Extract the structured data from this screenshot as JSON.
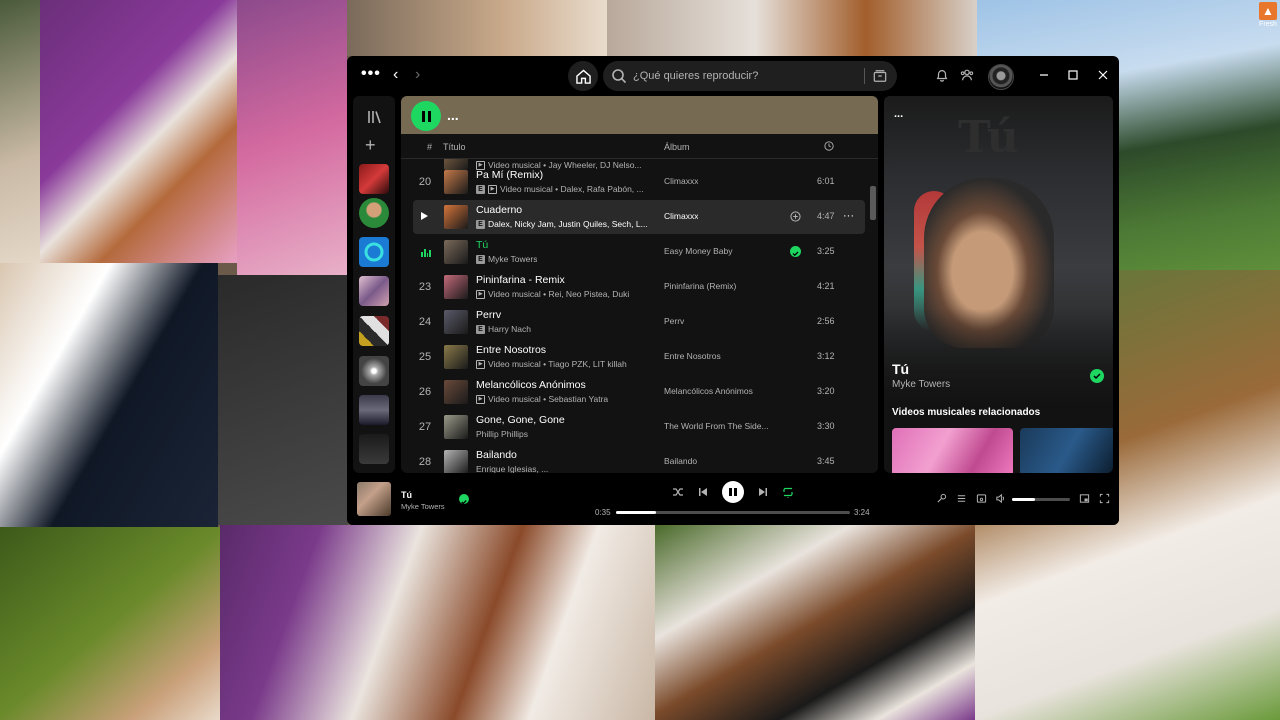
{
  "desktop": {
    "shortcut_label": "Fresh"
  },
  "titlebar": {
    "search_placeholder": "¿Qué quieres reproducir?"
  },
  "main": {
    "header_title": "...",
    "columns": {
      "num": "#",
      "title": "Título",
      "album": "Álbum"
    },
    "rows": [
      {
        "num": "",
        "title": "",
        "subtitle": "Video musical • Jay Wheeler, DJ Nelso...",
        "video": true,
        "explicit": false,
        "album": "",
        "duration": "",
        "state": "normal",
        "thumb": "#8a6a4a"
      },
      {
        "num": "20",
        "title": "Pa Mí (Remix)",
        "subtitle": "Video musical • Dalex, Rafa Pabón, ...",
        "video": true,
        "explicit": true,
        "album": "Climaxxx",
        "duration": "6:01",
        "state": "normal",
        "thumb": "#c47a4a"
      },
      {
        "num": "",
        "title": "Cuaderno",
        "subtitle": "Dalex, Nicky Jam, Justin Quiles, Sech, L...",
        "video": false,
        "explicit": true,
        "album": "Climaxxx",
        "duration": "4:47",
        "state": "hover",
        "thumb": "#d4743a"
      },
      {
        "num": "",
        "title": "Tú",
        "subtitle": "Myke Towers",
        "video": false,
        "explicit": true,
        "album": "Easy Money Baby",
        "duration": "3:25",
        "state": "playing",
        "thumb": "#7a6a5a"
      },
      {
        "num": "23",
        "title": "Pininfarina - Remix",
        "subtitle": "Video musical • Rei, Neo Pistea, Duki",
        "video": true,
        "explicit": false,
        "album": "Pininfarina (Remix)",
        "duration": "4:21",
        "state": "normal",
        "thumb": "#c46a7a"
      },
      {
        "num": "24",
        "title": "Perrv",
        "subtitle": "Harry Nach",
        "video": false,
        "explicit": true,
        "album": "Perrv",
        "duration": "2:56",
        "state": "normal",
        "thumb": "#5a5a6a"
      },
      {
        "num": "25",
        "title": "Entre Nosotros",
        "subtitle": "Video musical • Tiago PZK, LIT killah",
        "video": true,
        "explicit": false,
        "album": "Entre Nosotros",
        "duration": "3:12",
        "state": "normal",
        "thumb": "#8a7a4a"
      },
      {
        "num": "26",
        "title": "Melancólicos Anónimos",
        "subtitle": "Video musical • Sebastian Yatra",
        "video": true,
        "explicit": false,
        "album": "Melancólicos Anónimos",
        "duration": "3:20",
        "state": "normal",
        "thumb": "#6a4a3a"
      },
      {
        "num": "27",
        "title": "Gone, Gone, Gone",
        "subtitle": "Phillip Phillips",
        "video": false,
        "explicit": false,
        "album": "The World From The Side...",
        "duration": "3:30",
        "state": "normal",
        "thumb": "#9a9a8a"
      },
      {
        "num": "28",
        "title": "Bailando",
        "subtitle": "Enrique Iglesias, ...",
        "video": false,
        "explicit": false,
        "album": "Bailando",
        "duration": "3:45",
        "state": "normal",
        "thumb": "#b4b4b4"
      }
    ]
  },
  "right_panel": {
    "header": "...",
    "art_text": "Tú",
    "title": "Tú",
    "artist": "Myke Towers",
    "related_heading": "Videos musicales relacionados"
  },
  "player": {
    "title": "Tú",
    "artist": "Myke Towers",
    "time_current": "0:35",
    "time_total": "3:24",
    "progress_fraction": 0.17,
    "volume_fraction": 0.4
  },
  "colors": {
    "accent": "#1ed760",
    "header_bg": "#766b52"
  }
}
